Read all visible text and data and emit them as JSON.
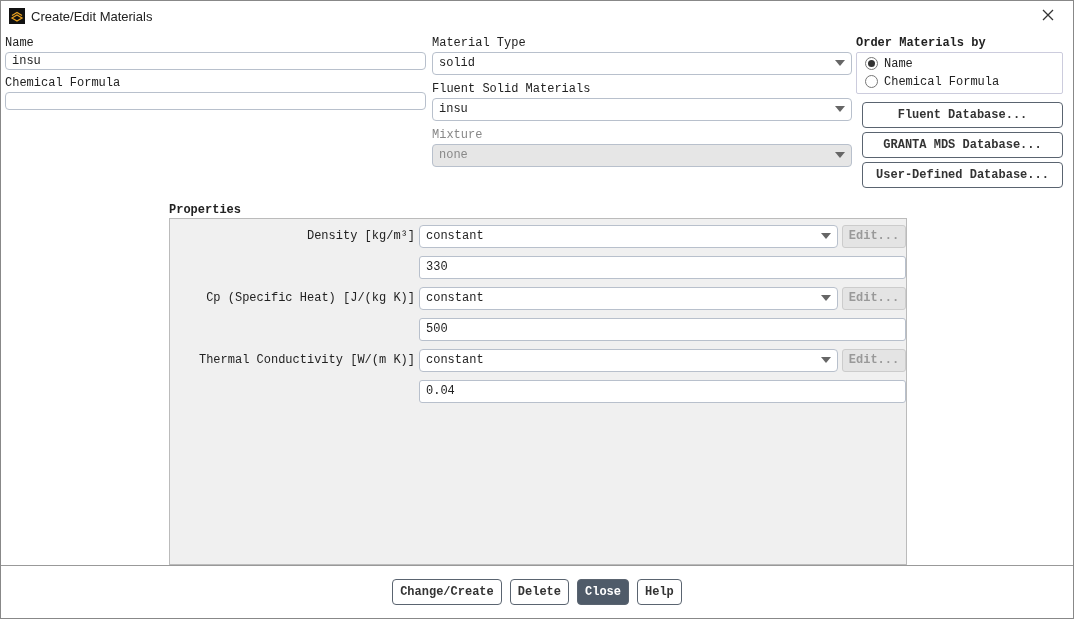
{
  "window": {
    "title": "Create/Edit Materials"
  },
  "name_field": {
    "label": "Name",
    "value": "insu"
  },
  "formula_field": {
    "label": "Chemical Formula"
  },
  "dropdowns": [
    {
      "label": "Material Type",
      "value": "solid",
      "disabled": false
    },
    {
      "label": "Fluent Solid Materials",
      "value": "insu",
      "disabled": false
    },
    {
      "label": "Mixture",
      "value": "none",
      "disabled": true
    }
  ],
  "order_by": {
    "title": "Order Materials by",
    "options": [
      {
        "label": "Name",
        "selected": true
      },
      {
        "label": "Chemical Formula",
        "selected": false
      }
    ]
  },
  "database_buttons": [
    "Fluent Database...",
    "GRANTA MDS Database...",
    "User-Defined Database..."
  ],
  "properties": {
    "title": "Properties",
    "rows": [
      {
        "label": "Density [kg/m³]",
        "method": "constant",
        "edit": "Edit...",
        "value": "330"
      },
      {
        "label": "Cp (Specific Heat) [J/(kg K)]",
        "method": "constant",
        "edit": "Edit...",
        "value": "500"
      },
      {
        "label": "Thermal Conductivity [W/(m K)]",
        "method": "constant",
        "edit": "Edit...",
        "value": "0.04"
      }
    ]
  },
  "buttons": [
    {
      "label": "Change/Create",
      "primary": false
    },
    {
      "label": "Delete",
      "primary": false
    },
    {
      "label": "Close",
      "primary": true
    },
    {
      "label": "Help",
      "primary": false
    }
  ]
}
